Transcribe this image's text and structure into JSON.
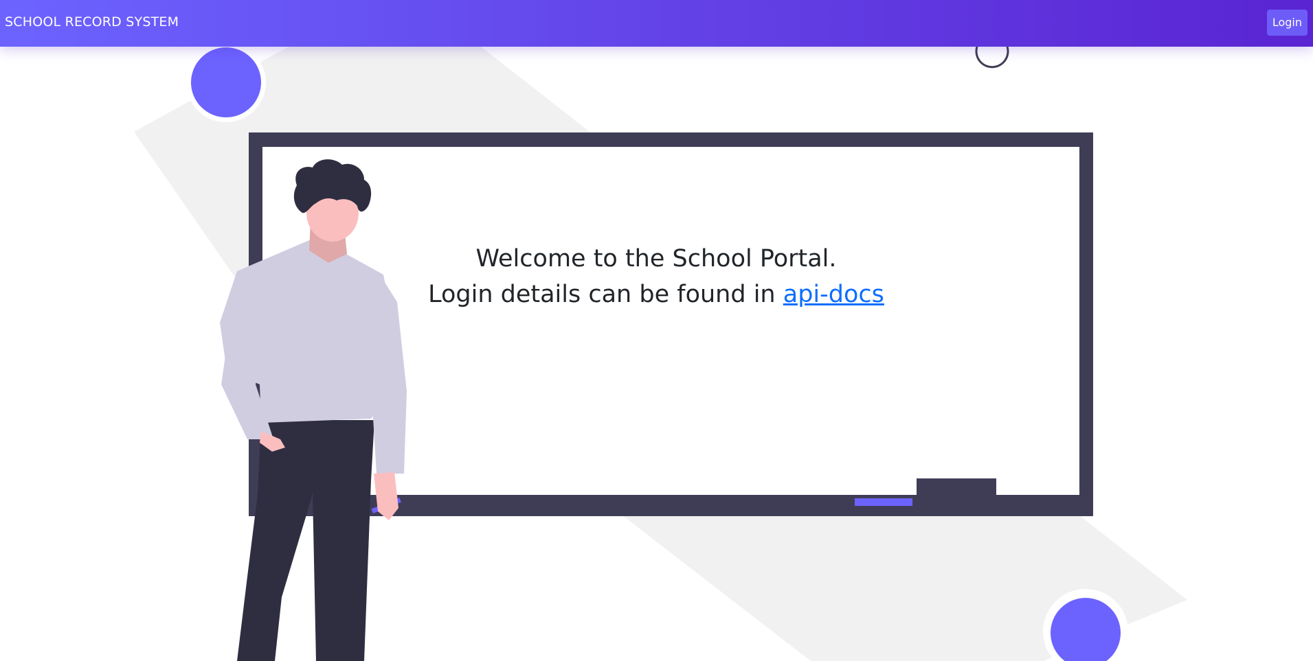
{
  "navbar": {
    "brand": "SCHOOL RECORD SYSTEM",
    "login_label": "Login"
  },
  "hero": {
    "welcome_line": "Welcome to the School Portal.",
    "details_prefix": "Login details can be found in",
    "docs_link": "api-docs"
  },
  "colors": {
    "nav_gradient_start": "#6c63ff",
    "nav_gradient_end": "#5a24d2",
    "accent": "#6c63ff",
    "board_frame": "#3f3d56",
    "link": "#0d6efd",
    "text": "#212529"
  }
}
